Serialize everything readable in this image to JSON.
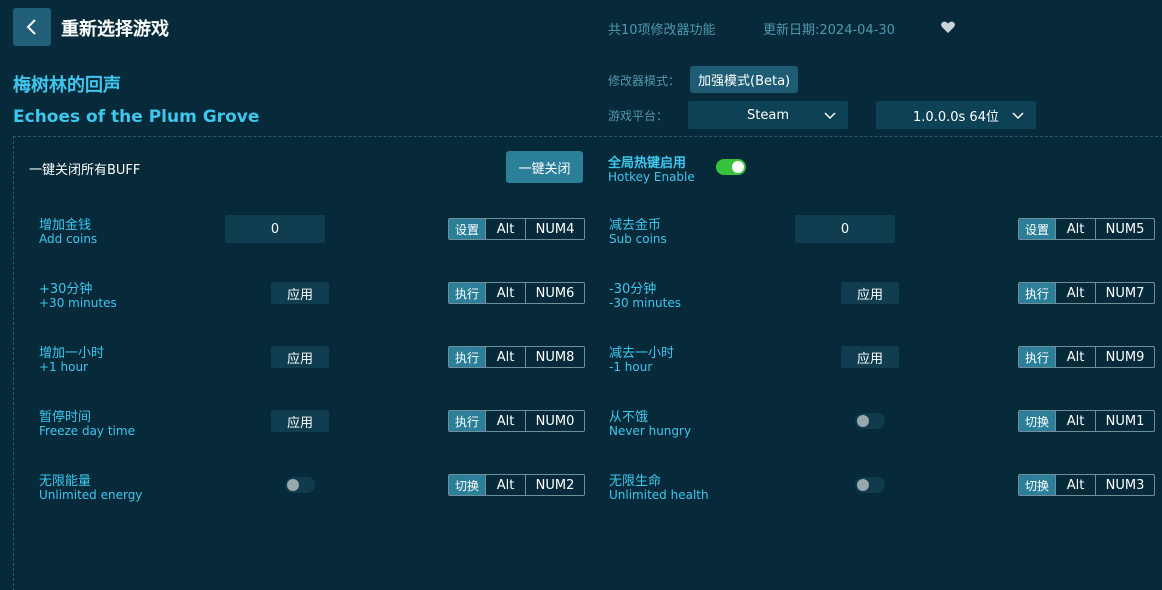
{
  "header": {
    "back_icon": "chevron-left-icon",
    "title": "重新选择游戏",
    "feature_count": "共10项修改器功能",
    "update_date": "更新日期:2024-04-30",
    "favorite_icon": "heart-icon"
  },
  "game": {
    "name_cn": "梅树林的回声",
    "name_en": "Echoes of the Plum Grove"
  },
  "settings": {
    "mode_label": "修改器模式：",
    "mode_value": "加强模式(Beta)",
    "platform_label": "游戏平台：",
    "platform_value": "Steam",
    "version_value": "1.0.0.0s 64位"
  },
  "global": {
    "buff_label": "一键关闭所有BUFF",
    "close_all_button": "一键关闭",
    "hotkey_cn": "全局热键启用",
    "hotkey_en": "Hotkey Enable",
    "hotkey_enabled": true
  },
  "cheats": [
    {
      "cn": "增加金钱",
      "en": "Add coins",
      "control": "input",
      "value": "0",
      "action": "设置",
      "mod": "Alt",
      "key": "NUM4"
    },
    {
      "cn": "减去金币",
      "en": "Sub coins",
      "control": "input",
      "value": "0",
      "action": "设置",
      "mod": "Alt",
      "key": "NUM5"
    },
    {
      "cn": "+30分钟",
      "en": "+30 minutes",
      "control": "button",
      "value": "应用",
      "action": "执行",
      "mod": "Alt",
      "key": "NUM6"
    },
    {
      "cn": "-30分钟",
      "en": "-30 minutes",
      "control": "button",
      "value": "应用",
      "action": "执行",
      "mod": "Alt",
      "key": "NUM7"
    },
    {
      "cn": "增加一小时",
      "en": "+1 hour",
      "control": "button",
      "value": "应用",
      "action": "执行",
      "mod": "Alt",
      "key": "NUM8"
    },
    {
      "cn": "减去一小时",
      "en": "-1 hour",
      "control": "button",
      "value": "应用",
      "action": "执行",
      "mod": "Alt",
      "key": "NUM9"
    },
    {
      "cn": "暂停时间",
      "en": "Freeze day time",
      "control": "button",
      "value": "应用",
      "action": "执行",
      "mod": "Alt",
      "key": "NUM0"
    },
    {
      "cn": "从不饿",
      "en": "Never hungry",
      "control": "toggle",
      "action": "切换",
      "mod": "Alt",
      "key": "NUM1"
    },
    {
      "cn": "无限能量",
      "en": "Unlimited energy",
      "control": "toggle",
      "action": "切换",
      "mod": "Alt",
      "key": "NUM2"
    },
    {
      "cn": "无限生命",
      "en": "Unlimited health",
      "control": "toggle",
      "action": "切换",
      "mod": "Alt",
      "key": "NUM3"
    }
  ],
  "colors": {
    "background": "#062a39",
    "accent": "#3fc6ee",
    "button": "#2c7f98",
    "toggle_on": "#38c23c"
  }
}
